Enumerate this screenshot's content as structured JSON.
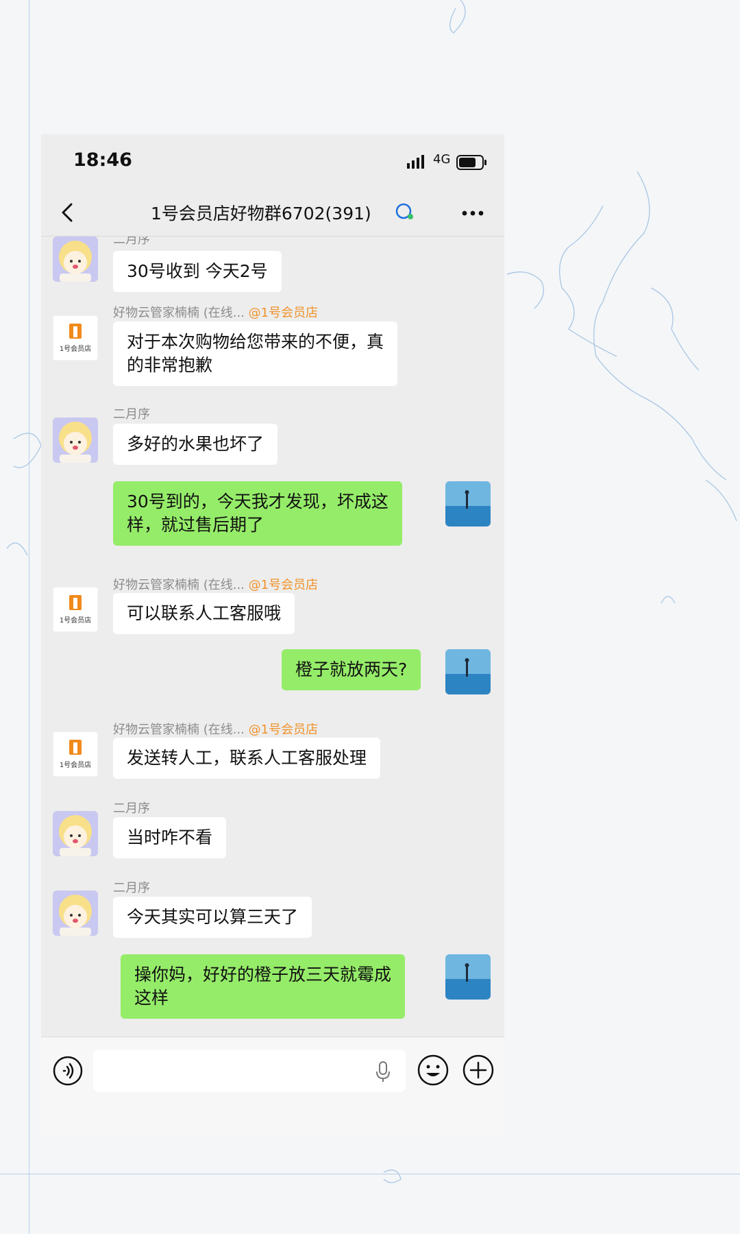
{
  "status_bar": {
    "time": "18:46",
    "network": "4G"
  },
  "header": {
    "title": "1号会员店好物群6702(391)"
  },
  "senders": {
    "user_a": "二月序",
    "bot_name": "好物云管家楠楠 (在线...",
    "bot_tag": "@1号会员店",
    "bot_logo_text": "1号会员店"
  },
  "messages": [
    {
      "side": "left",
      "sender": "二月序",
      "lines": [
        "30号收到 今天2号"
      ]
    },
    {
      "side": "left",
      "sender": "好物云管家楠楠 (在线...",
      "lines": [
        "对于本次购物给您带来的不便，真",
        "的非常抱歉"
      ]
    },
    {
      "side": "left",
      "sender": "二月序",
      "lines": [
        "多好的水果也坏了"
      ]
    },
    {
      "side": "right",
      "lines": [
        "30号到的，今天我才发现，坏成这",
        "样，就过售后期了"
      ]
    },
    {
      "side": "left",
      "sender": "好物云管家楠楠 (在线...",
      "lines": [
        "可以联系人工客服哦"
      ]
    },
    {
      "side": "right",
      "lines": [
        "橙子就放两天?"
      ]
    },
    {
      "side": "left",
      "sender": "好物云管家楠楠 (在线...",
      "lines": [
        "发送转人工，联系人工客服处理"
      ]
    },
    {
      "side": "left",
      "sender": "二月序",
      "lines": [
        "当时咋不看"
      ]
    },
    {
      "side": "left",
      "sender": "二月序",
      "lines": [
        "今天其实可以算三天了"
      ]
    },
    {
      "side": "right",
      "lines": [
        "操你妈，好好的橙子放三天就霉成",
        "这样"
      ]
    }
  ],
  "colors": {
    "self_bubble": "#95ec69",
    "other_bubble": "#ffffff",
    "chat_bg": "#ededed",
    "bot_tag": "#f0922a"
  }
}
